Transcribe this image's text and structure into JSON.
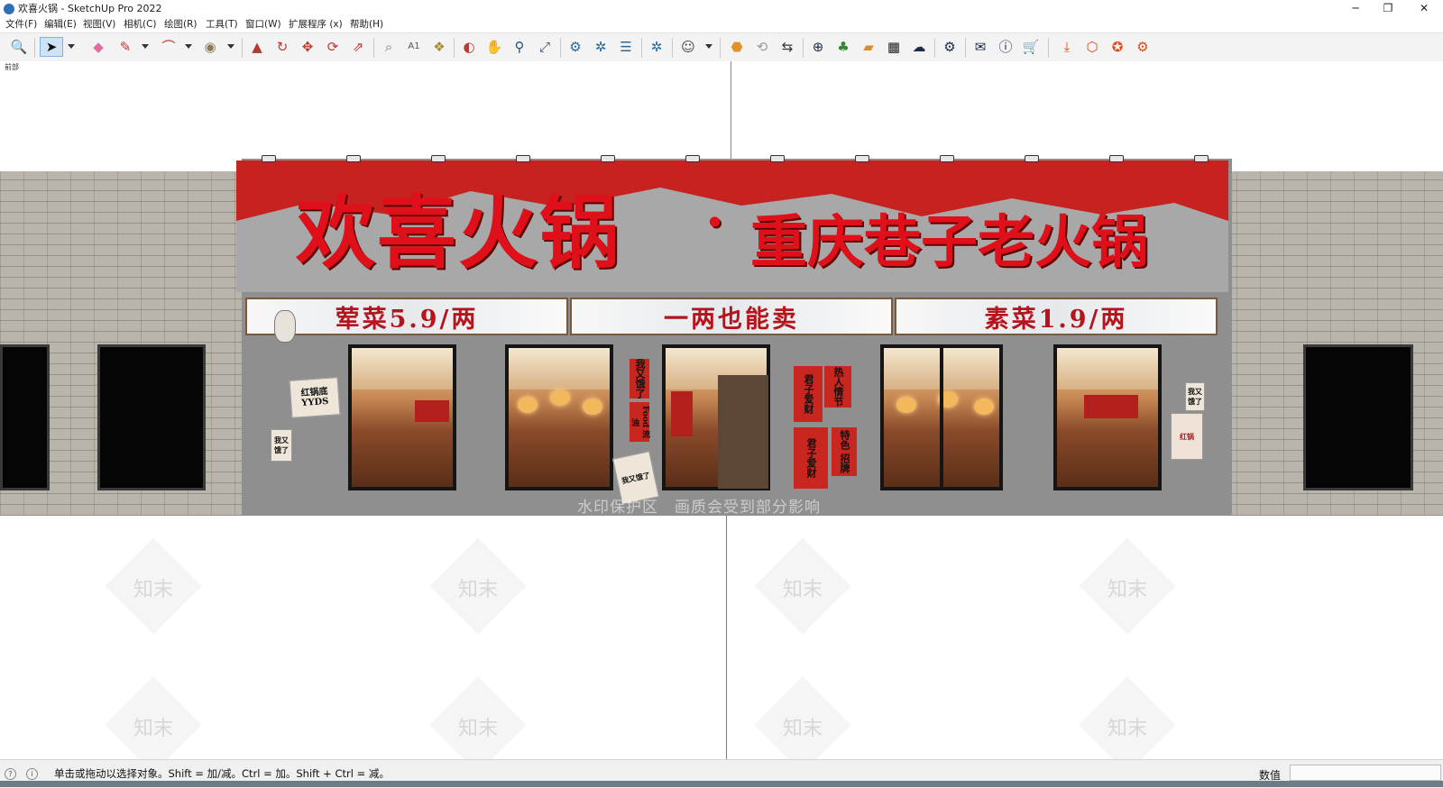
{
  "window": {
    "title": "欢喜火锅 - SketchUp Pro 2022",
    "minimize_glyph": "─",
    "restore_glyph": "❐",
    "close_glyph": "✕"
  },
  "menu": [
    "文件(F)",
    "编辑(E)",
    "视图(V)",
    "相机(C)",
    "绘图(R)",
    "工具(T)",
    "窗口(W)",
    "扩展程序 (x)",
    "帮助(H)"
  ],
  "toolbar": {
    "icons": [
      "zoom-icon",
      "select-icon",
      "eraser-icon",
      "pencil-icon",
      "arc-icon",
      "paint-bucket-icon",
      "push-pull-icon",
      "follow-me-icon",
      "move-icon",
      "rotate-icon",
      "scale-icon",
      "tape-measure-icon",
      "text-icon",
      "paint-icon",
      "orbit-icon",
      "pan-icon",
      "zoom-window-icon",
      "zoom-extents-icon",
      "warehouse-icon",
      "components-icon",
      "layers-icon",
      "outliner-icon",
      "account-icon",
      "extension-icon",
      "sync-icon",
      "presentation-icon",
      "add-icon",
      "tree-icon",
      "section-icon",
      "checker-icon",
      "cloud-icon",
      "settings-icon",
      "mail-icon",
      "info-icon",
      "cart-icon",
      "download-icon",
      "upload-icon",
      "plugin-icon",
      "gear-icon"
    ]
  },
  "scene": {
    "label": "前部",
    "brand_part1": "欢喜火锅",
    "brand_dot": "·",
    "brand_part2": "重庆巷子老火锅",
    "price_left": "荤菜5.9/两",
    "price_center": "一两也能卖",
    "price_right": "素菜1.9/两",
    "poster_red_base": "红锅底YYDS",
    "poster_eat": "我又饿了",
    "poster_food": "Food 流油",
    "poster_guest": "君子爱财",
    "poster_hot": "热人情节",
    "poster_special": "特色 招牌",
    "poster_right": "红锅",
    "watermark_center": "水印保护区　画质会受到部分影响",
    "watermark_text": "知末"
  },
  "status": {
    "message": "单击或拖动以选择对象。Shift = 加/减。Ctrl = 加。Shift + Ctrl = 减。",
    "measurements_label": "数值",
    "measurements_value": ""
  },
  "colors": {
    "sign_red": "#c6221f",
    "brand_text": "#e0101a",
    "price_text": "#b5141c",
    "toolbar_bg": "#f3f3f3",
    "active_tool": "#cfe3f6"
  }
}
